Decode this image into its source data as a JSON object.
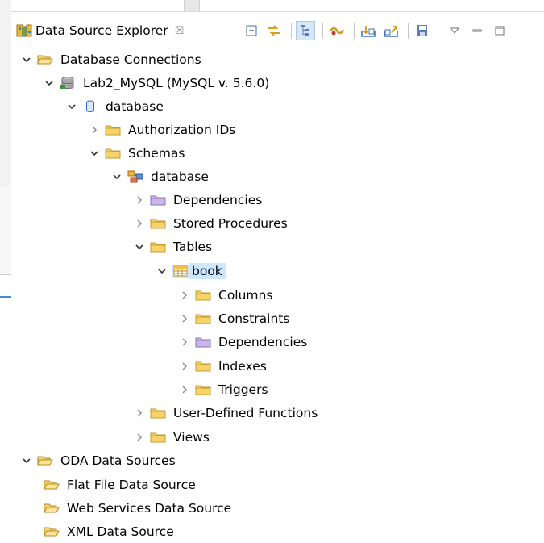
{
  "view": {
    "title": "Data Source Explorer",
    "close_glyph": "☒"
  },
  "toolbar": {
    "buttons": [
      {
        "name": "collapse-all-icon"
      },
      {
        "name": "link-with-editor-icon"
      },
      {
        "name": "tree-layout-icon",
        "active": true
      },
      {
        "name": "new-connection-icon"
      },
      {
        "name": "import-icon"
      },
      {
        "name": "export-icon"
      },
      {
        "name": "save-icon"
      },
      {
        "name": "view-menu-icon"
      },
      {
        "name": "minimize-icon"
      },
      {
        "name": "maximize-icon"
      }
    ]
  },
  "tree": {
    "database_connections": "Database Connections",
    "lab2": "Lab2_MySQL (MySQL v. 5.6.0)",
    "database": "database",
    "authorization_ids": "Authorization IDs",
    "schemas": "Schemas",
    "schema_database": "database",
    "dependencies": "Dependencies",
    "stored_procedures": "Stored Procedures",
    "tables": "Tables",
    "book": "book",
    "columns": "Columns",
    "constraints": "Constraints",
    "book_dependencies": "Dependencies",
    "indexes": "Indexes",
    "triggers": "Triggers",
    "user_defined_functions": "User-Defined Functions",
    "views": "Views",
    "oda_data_sources": "ODA Data Sources",
    "flat_file": "Flat File Data Source",
    "web_services": "Web Services Data Source",
    "xml": "XML Data Source"
  },
  "colors": {
    "folder": "#f6d46a",
    "folder_outline": "#c99a2e",
    "purple_folder": "#c9b8e6",
    "selection": "#cce8ff",
    "accent": "#3d8fd6"
  }
}
